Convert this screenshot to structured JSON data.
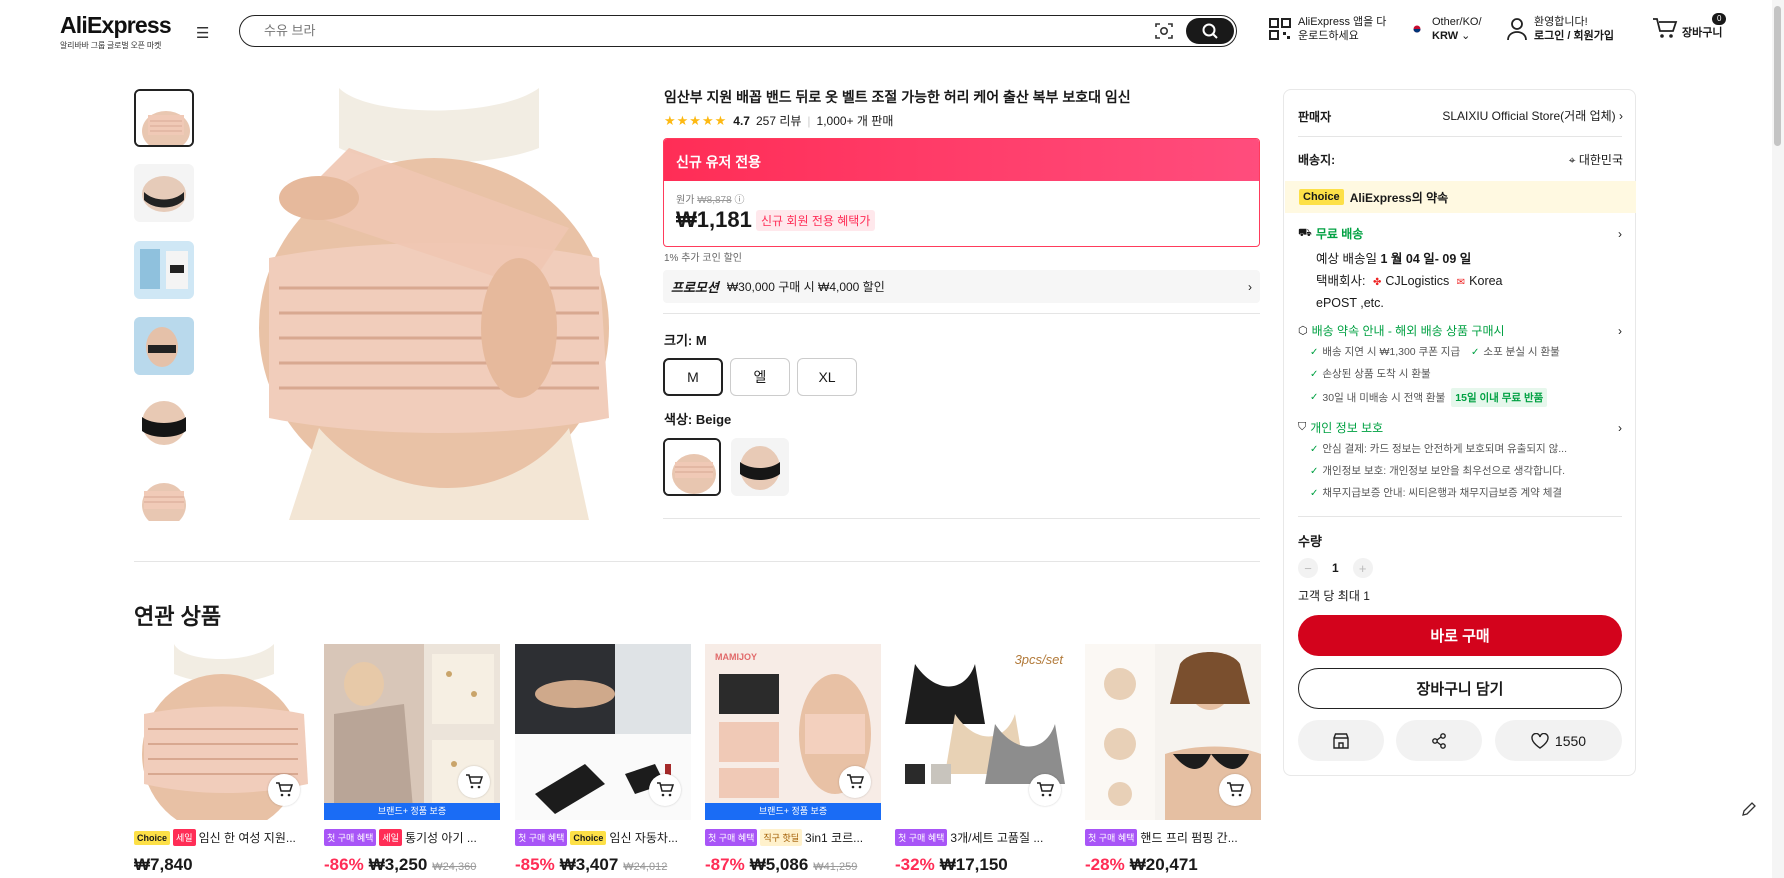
{
  "header": {
    "logo": "AliExpress",
    "logo_sub": "알리바바 그룹 글로벌 오픈 마켓",
    "search_placeholder": "수유 브라",
    "app_line1": "AliExpress 앱을 다",
    "app_line2": "운로드하세요",
    "region_line1": "Other/KO/",
    "region_line2": "KRW",
    "user_line1": "환영합니다!",
    "user_line2": "로그인 / 회원가입",
    "cart_count": "0",
    "cart_label": "장바구니"
  },
  "product": {
    "title": "임산부 지원 배꼽 밴드 뒤로 옷 벨트 조절 가능한 허리 케어 출산 복부 보호대 임신",
    "rating": "4.7",
    "reviews": "257 리뷰",
    "sold": "1,000+ 개 판매",
    "promo_header": "신규 유저 전용",
    "orig_label": "원가",
    "orig_price": "₩8,878",
    "price": "₩1,181",
    "price_tag": "신규 회원 전용 혜택가",
    "coin_note": "1% 추가 코인 할인",
    "promotion_label": "프로모션",
    "promotion_text": "₩30,000 구매 시 ₩4,000 할인",
    "size_label": "크기: M",
    "sizes": [
      "M",
      "엘",
      "XL"
    ],
    "color_label": "색상: Beige"
  },
  "related": {
    "title": "연관 상품",
    "brand_plus": "브랜드+ 정품 보증",
    "items": [
      {
        "badges": [
          "Choice",
          "세일"
        ],
        "title": "임신 한 여성 지원...",
        "discount": "",
        "price": "₩7,840",
        "orig": ""
      },
      {
        "badges": [
          "첫 구매 혜택",
          "세일"
        ],
        "title": "통기성 아기 ...",
        "discount": "-86%",
        "price": "₩3,250",
        "orig": "₩24,360"
      },
      {
        "badges": [
          "첫 구매 혜택",
          "Choice"
        ],
        "title": "임신 자동차...",
        "discount": "-85%",
        "price": "₩3,407",
        "orig": "₩24,012"
      },
      {
        "badges": [
          "첫 구매 혜택",
          "직구 핫딜"
        ],
        "title": "3in1 코르...",
        "discount": "-87%",
        "price": "₩5,086",
        "orig": "₩41,259"
      },
      {
        "badges": [
          "첫 구매 혜택"
        ],
        "title": "3개/세트 고품질 ...",
        "discount": "-32%",
        "price": "₩17,150",
        "orig": ""
      },
      {
        "badges": [
          "첫 구매 혜택"
        ],
        "title": "핸드 프리 펌핑 간...",
        "discount": "-28%",
        "price": "₩20,471",
        "orig": ""
      }
    ],
    "img_text_mamijoy": "MAMIJOY",
    "img_text_3pcs": "3pcs/set"
  },
  "side": {
    "seller_label": "판매자",
    "seller_name": "SLAIXIU Official Store(거래 업체)",
    "ship_label": "배송지:",
    "ship_dest": "대한민국",
    "choice_badge": "Choice",
    "choice_text": "AliExpress의 약속",
    "free_ship": "무료 배송",
    "eta_prefix": "예상 배송일",
    "eta": "1 월 04 일- 09 일",
    "carrier_label": "택배회사:",
    "carrier_1": "CJLogistics",
    "carrier_2": "Korea",
    "carrier_3": "ePOST ,etc.",
    "promise_title": "배송 약속 안내 - 해외 배송 상품 구매시",
    "promise_items": [
      "배송 지연 시 ₩1,300 쿠폰 지급",
      "소포 분실 시 환불",
      "손상된 상품 도착 시 환불",
      "30일 내 미배송 시 전액 환불"
    ],
    "return_badge": "15일 이내 무료 반품",
    "privacy_title": "개인 정보 보호",
    "privacy_items": [
      "안심 결제: 카드 정보는 안전하게 보호되며 유출되지 않...",
      "개인정보 보호: 개인정보 보안을 최우선으로 생각합니다.",
      "채무지급보증 안내: 씨티은행과 채무지급보증 계약 체결"
    ],
    "qty_label": "수량",
    "qty_value": "1",
    "qty_limit": "고객 당 최대 1",
    "buy_now": "바로 구매",
    "add_cart": "장바구니 담기",
    "wishlist_count": "1550"
  },
  "colors": {
    "accent_red": "#d3031c",
    "sale_pink": "#ff2d56",
    "choice_yellow": "#fde047",
    "green": "#00a142"
  }
}
